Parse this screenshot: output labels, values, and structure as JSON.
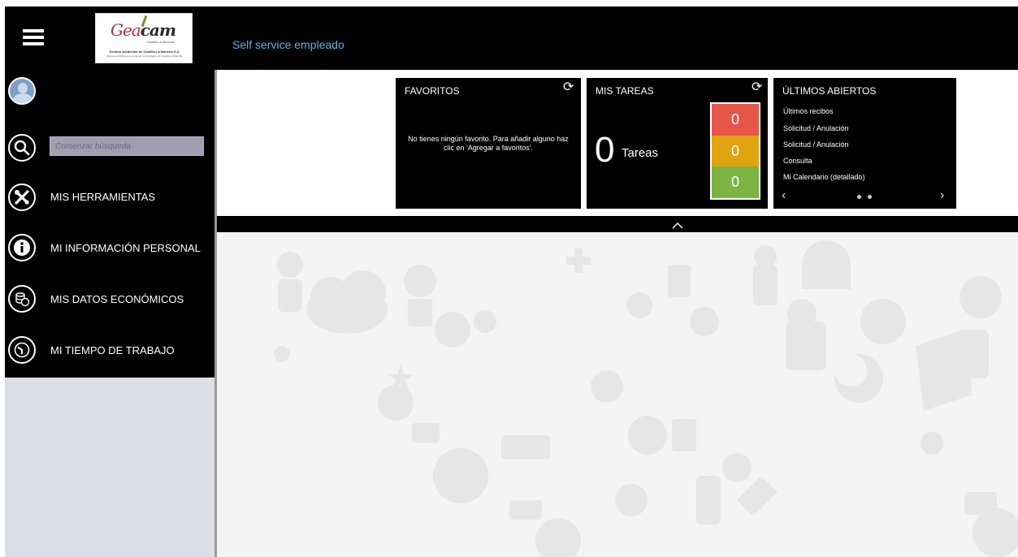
{
  "header": {
    "app_title": "Self service empleado",
    "logo": {
      "mark_left": "Gea",
      "mark_right": "cam",
      "tagline": "Castilla-La Mancha",
      "subtitle": "Gestión Ambiental de Castilla-La Mancha S.A.",
      "subtitle2": "Empresa Pública de la Junta de Comunidades de Castilla-La Mancha"
    }
  },
  "sidebar": {
    "search_placeholder": "Comenzar búsqueda",
    "items": [
      {
        "label": "MIS HERRAMIENTAS",
        "icon": "tools-icon"
      },
      {
        "label": "MI INFORMACIÓN PERSONAL",
        "icon": "info-icon"
      },
      {
        "label": "MIS DATOS ECONÓMICOS",
        "icon": "coins-icon"
      },
      {
        "label": "MI TIEMPO DE TRABAJO",
        "icon": "clock-icon"
      }
    ]
  },
  "widgets": {
    "favorites": {
      "title": "FAVORITOS",
      "message": "No tienes ningún favorito. Para añadir alguno haz clic en 'Agregar a favoritos'."
    },
    "tasks": {
      "title": "MIS TAREAS",
      "count": "0",
      "count_label": "Tareas",
      "cells": [
        {
          "value": "0",
          "color": "#e8564a"
        },
        {
          "value": "0",
          "color": "#e0a410"
        },
        {
          "value": "0",
          "color": "#7cb342"
        }
      ]
    },
    "recent": {
      "title": "ÚLTIMOS ABIERTOS",
      "items": [
        "Últimos recibos",
        "Solicitud / Anulación",
        "Solicitud / Anulación",
        "Consulta",
        "Mi Calendario (detallado)"
      ]
    }
  },
  "colors": {
    "accent": "#5ab4e6",
    "sidebar_bg": "#000000",
    "sidebar_lower": "#dcdfe8"
  }
}
